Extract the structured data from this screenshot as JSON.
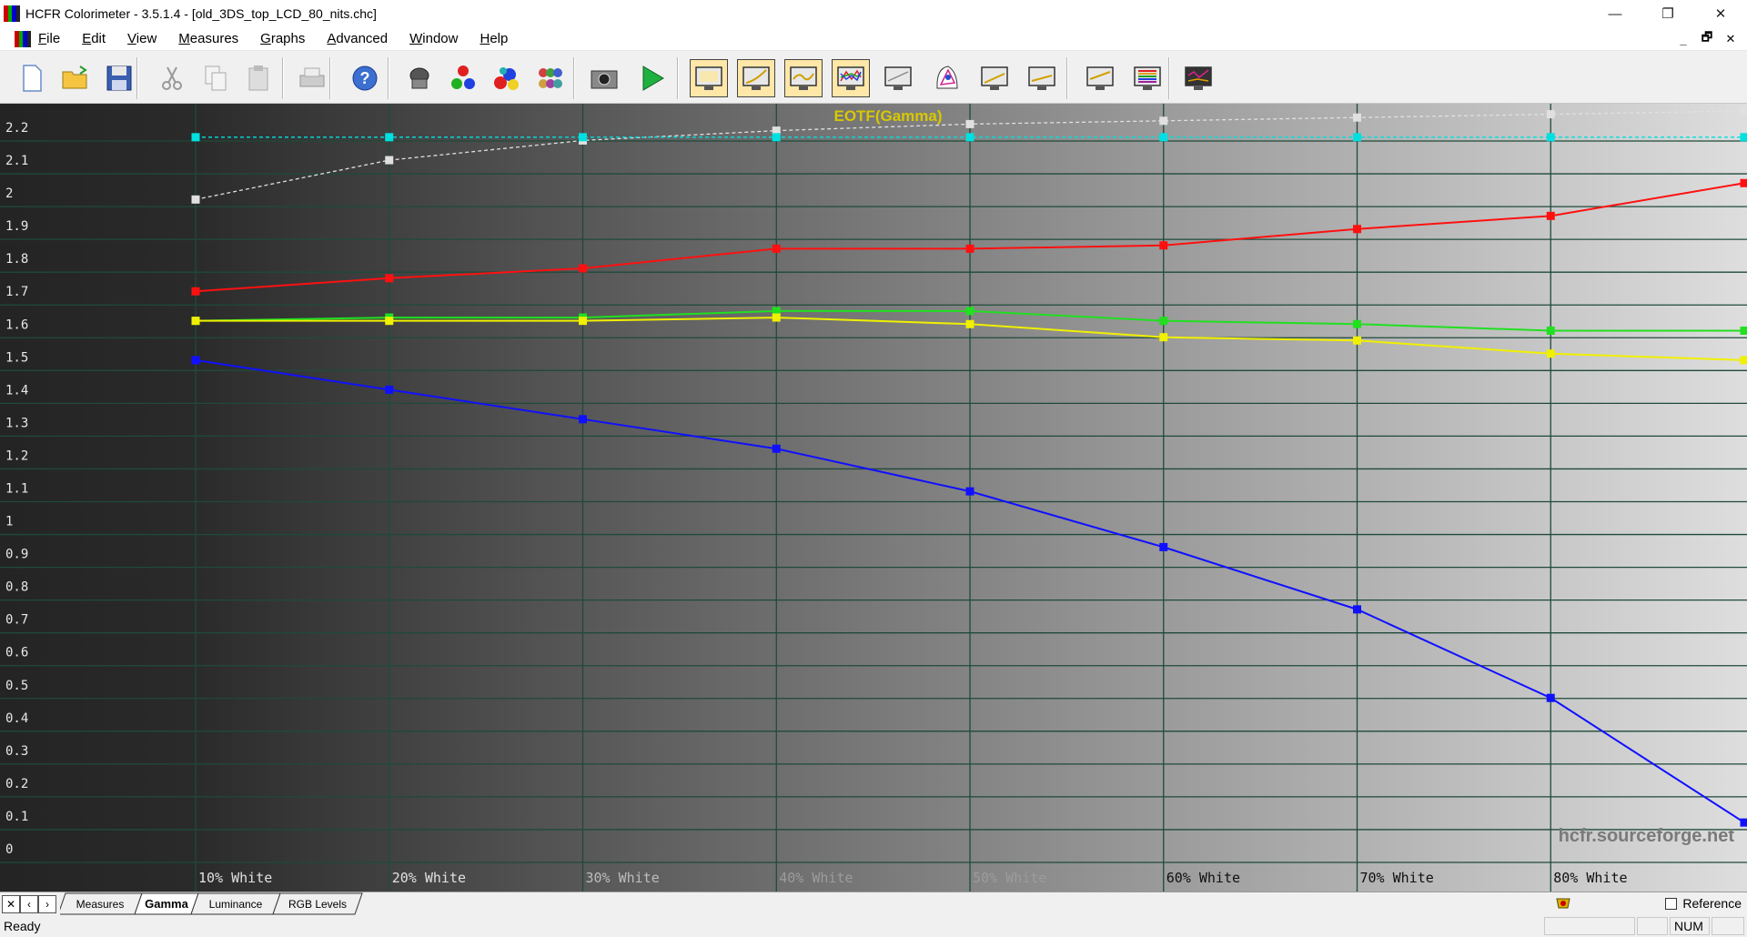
{
  "window": {
    "title": "HCFR Colorimeter - 3.5.1.4 - [old_3DS_top_LCD_80_nits.chc]",
    "minimize_glyph": "—",
    "restore_glyph": "❐",
    "close_glyph": "✕"
  },
  "menu": {
    "items": [
      {
        "label": "File",
        "accel": "F"
      },
      {
        "label": "Edit",
        "accel": "E"
      },
      {
        "label": "View",
        "accel": "V"
      },
      {
        "label": "Measures",
        "accel": "M"
      },
      {
        "label": "Graphs",
        "accel": "G"
      },
      {
        "label": "Advanced",
        "accel": "A"
      },
      {
        "label": "Window",
        "accel": "W"
      },
      {
        "label": "Help",
        "accel": "H"
      }
    ],
    "mdi_minimize": "_",
    "mdi_restore": "🗗",
    "mdi_close": "✕"
  },
  "toolbar": {
    "buttons": [
      {
        "icon": "new-document-icon"
      },
      {
        "icon": "open-folder-icon"
      },
      {
        "icon": "save-icon"
      },
      {
        "icon": "cut-icon"
      },
      {
        "icon": "copy-icon"
      },
      {
        "icon": "paste-icon"
      },
      {
        "icon": "print-icon"
      },
      {
        "icon": "help-icon"
      },
      {
        "icon": "sensor-icon"
      },
      {
        "icon": "rgb-balls-icon"
      },
      {
        "icon": "color-balls-icon"
      },
      {
        "icon": "multi-balls-icon"
      },
      {
        "icon": "camera-icon"
      },
      {
        "icon": "play-icon"
      },
      {
        "icon": "measures-view-icon"
      },
      {
        "icon": "gamma-view-icon"
      },
      {
        "icon": "luminance-view-icon"
      },
      {
        "icon": "rgb-levels-view-icon"
      },
      {
        "icon": "color-temp-view-icon"
      },
      {
        "icon": "cie-chart-icon"
      },
      {
        "icon": "saturation-view-icon"
      },
      {
        "icon": "near-black-view-icon"
      },
      {
        "icon": "near-white-view-icon"
      },
      {
        "icon": "color-comparator-icon"
      },
      {
        "icon": "saturation-luminance-icon"
      }
    ]
  },
  "chart_data": {
    "type": "line",
    "title": "EOTF(Gamma)",
    "watermark": "hcfr.sourceforge.net",
    "x_labels": [
      "10% White",
      "20% White",
      "30% White",
      "40% White",
      "50% White",
      "60% White",
      "70% White",
      "80% White"
    ],
    "y_ticks": [
      "0",
      "0.1",
      "0.2",
      "0.3",
      "0.4",
      "0.5",
      "0.6",
      "0.7",
      "0.8",
      "0.9",
      "1",
      "1.1",
      "1.2",
      "1.3",
      "1.4",
      "1.5",
      "1.6",
      "1.7",
      "1.8",
      "1.9",
      "2",
      "2.1",
      "2.2"
    ],
    "ylim": [
      0,
      2.2
    ],
    "x": [
      10,
      20,
      30,
      40,
      50,
      60,
      70,
      80,
      90
    ],
    "xlim": [
      10,
      90
    ],
    "grid": true,
    "series": [
      {
        "color": "#e0e0e0",
        "dashed": true,
        "values": [
          1.98,
          2.1,
          2.16,
          2.19,
          2.21,
          2.22,
          2.23,
          2.24,
          2.25
        ]
      },
      {
        "color": "#00e0e0",
        "dashed": true,
        "values": [
          2.17,
          2.17,
          2.17,
          2.17,
          2.17,
          2.17,
          2.17,
          2.17,
          2.17
        ]
      },
      {
        "color": "#ff1010",
        "dashed": false,
        "values": [
          1.7,
          1.74,
          1.77,
          1.83,
          1.83,
          1.84,
          1.89,
          1.93,
          2.03
        ]
      },
      {
        "color": "#20e020",
        "dashed": false,
        "values": [
          1.61,
          1.62,
          1.62,
          1.64,
          1.64,
          1.61,
          1.6,
          1.58,
          1.58
        ]
      },
      {
        "color": "#f0f000",
        "dashed": false,
        "values": [
          1.61,
          1.61,
          1.61,
          1.62,
          1.6,
          1.56,
          1.55,
          1.51,
          1.49
        ]
      },
      {
        "color": "#1010ff",
        "dashed": false,
        "values": [
          1.49,
          1.4,
          1.31,
          1.22,
          1.09,
          0.92,
          0.73,
          0.46,
          0.08
        ]
      }
    ]
  },
  "tabs": {
    "first_glyph": "✕",
    "prev_glyph": "‹",
    "next_glyph": "›",
    "items": [
      "Measures",
      "Gamma",
      "Luminance",
      "RGB Levels"
    ],
    "active": "Gamma",
    "reference_label": "Reference"
  },
  "status": {
    "text": "Ready",
    "num": "NUM"
  }
}
